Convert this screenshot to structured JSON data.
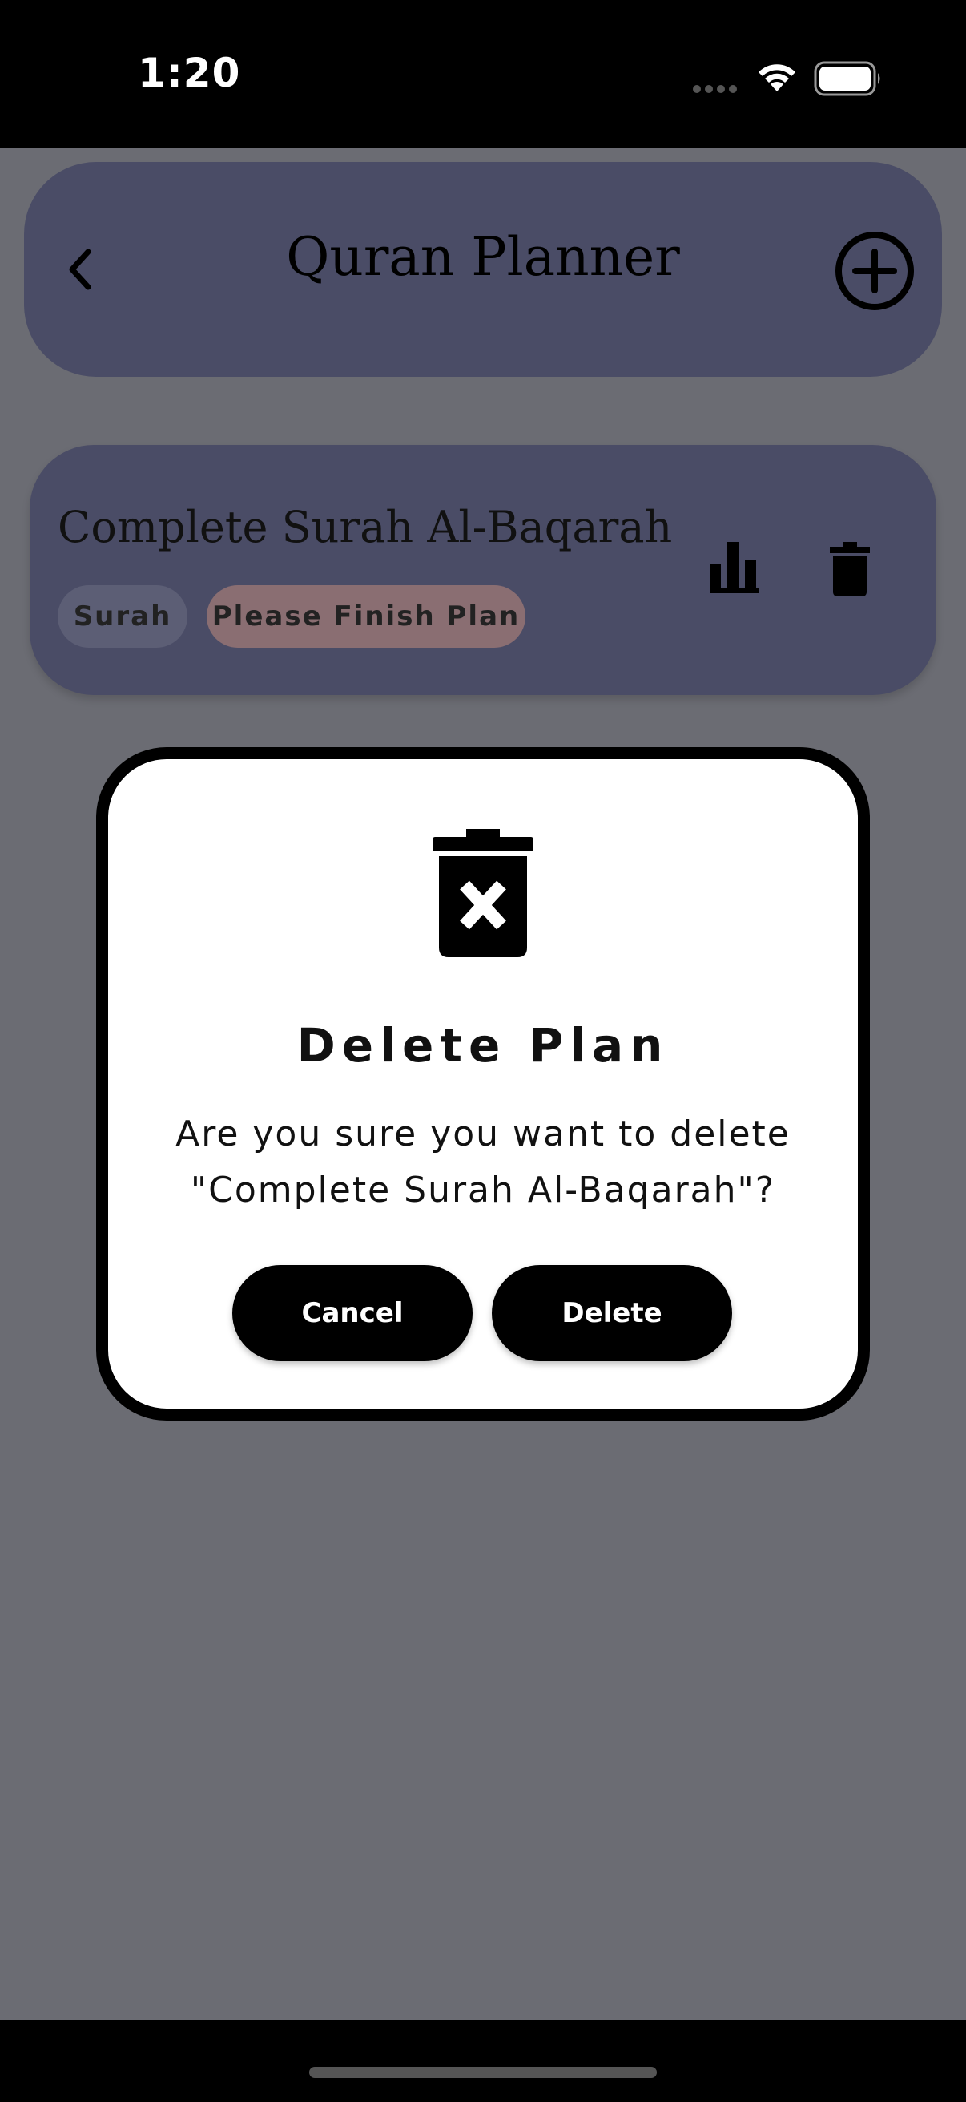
{
  "status_bar": {
    "time": "1:20"
  },
  "header": {
    "title": "Quran Planner",
    "back_icon": "chevron-left-icon",
    "add_icon": "plus-circle-icon"
  },
  "plan": {
    "title": "Complete Surah Al-Baqarah",
    "type_chip": "Surah",
    "status_chip": "Please Finish Plan",
    "stats_icon": "bar-chart-icon",
    "delete_icon": "trash-icon"
  },
  "dialog": {
    "icon": "trash-x-icon",
    "title": "Delete Plan",
    "message": "Are you sure you want to delete \"Complete Surah Al-Baqarah\"?",
    "cancel_label": "Cancel",
    "delete_label": "Delete"
  },
  "colors": {
    "overlay_background": "#6b6c73",
    "card_background": "#4a4c66",
    "status_chip_background": "#8a6e72",
    "dialog_background": "#ffffff",
    "button_background": "#000000"
  }
}
